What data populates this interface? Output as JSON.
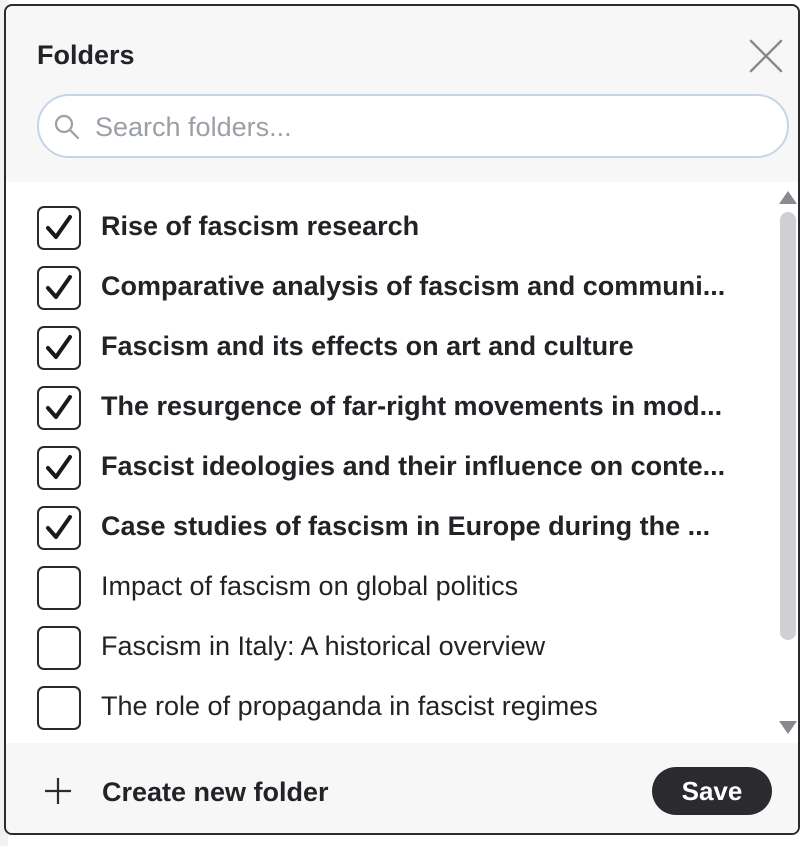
{
  "dialog": {
    "title": "Folders",
    "close_icon": "close-icon",
    "search": {
      "placeholder": "Search folders...",
      "value": "",
      "icon": "search-icon"
    }
  },
  "folders": [
    {
      "label": "Rise of fascism research",
      "checked": true
    },
    {
      "label": "Comparative analysis of fascism and communi...",
      "checked": true
    },
    {
      "label": "Fascism and its effects on art and culture",
      "checked": true
    },
    {
      "label": "The resurgence of far-right movements in mod...",
      "checked": true
    },
    {
      "label": "Fascist ideologies and their influence on conte...",
      "checked": true
    },
    {
      "label": "Case studies of fascism in Europe during the ...",
      "checked": true
    },
    {
      "label": "Impact of fascism on global politics",
      "checked": false
    },
    {
      "label": "Fascism in Italy: A historical overview",
      "checked": false
    },
    {
      "label": "The role of propaganda in fascist regimes",
      "checked": false
    }
  ],
  "footer": {
    "create_label": "Create new folder",
    "create_icon": "plus-icon",
    "save_label": "Save"
  },
  "colors": {
    "dark": "#2b2b2f",
    "search_border": "#c6d4ea",
    "scrollbar": "#cfd0d4",
    "panel_bg": "#f7f7f8"
  }
}
